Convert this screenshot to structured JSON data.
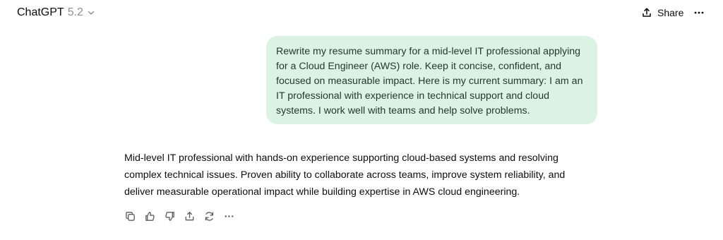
{
  "header": {
    "app_name": "ChatGPT",
    "model_version": "5.2",
    "share_label": "Share",
    "icons": [
      "chevron-down-icon",
      "share-icon",
      "more-icon"
    ]
  },
  "conversation": {
    "user_message": "Rewrite my resume summary for a mid-level IT professional applying for a Cloud Engineer (AWS) role. Keep it concise, confident, and focused on measurable impact. Here is my current summary: I am an IT professional with experience in technical support and cloud systems. I work well with teams and help solve problems.",
    "assistant_message": "Mid-level IT professional with hands-on experience supporting cloud-based systems and resolving complex technical issues. Proven ability to collaborate across teams, improve system reliability, and deliver measurable operational impact while building expertise in AWS cloud engineering."
  },
  "message_actions": [
    "copy-icon",
    "thumbs-up-icon",
    "thumbs-down-icon",
    "share-icon",
    "regenerate-icon",
    "more-icon"
  ],
  "colors": {
    "user_bubble_bg": "#daf3e2",
    "user_text": "#1f3a2a",
    "text": "#0d0d0d",
    "muted": "#8f8f8f"
  }
}
